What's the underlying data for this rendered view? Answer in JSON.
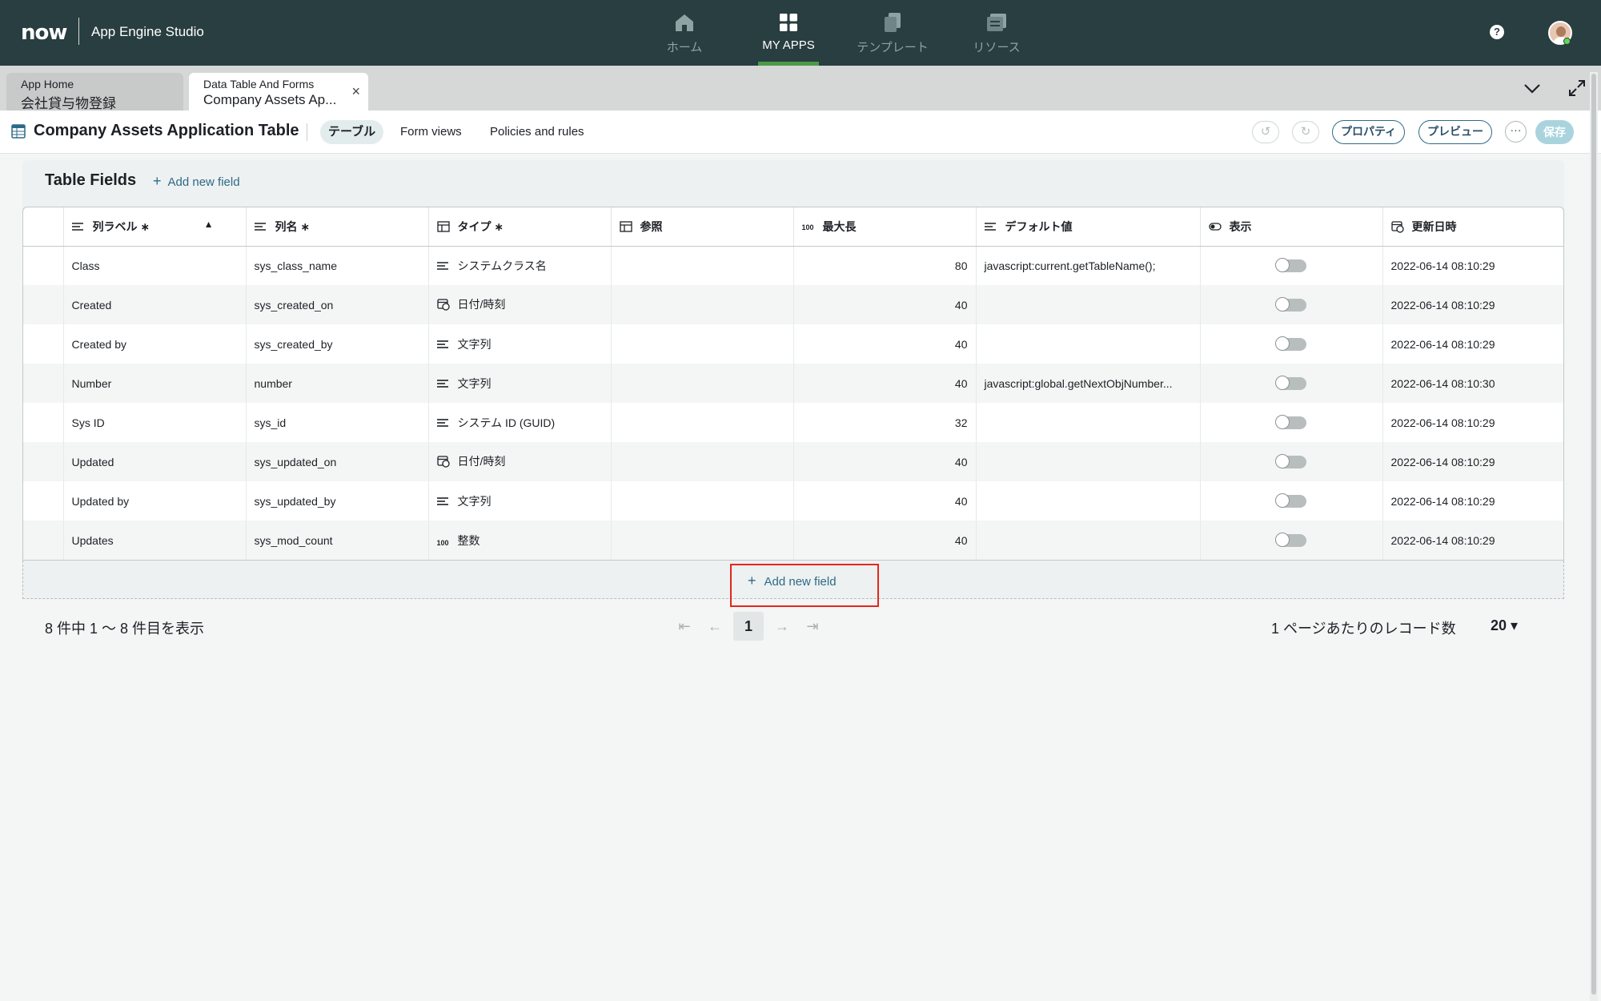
{
  "header": {
    "logo": "now",
    "app_name": "App Engine Studio",
    "nav": [
      {
        "label": "ホーム",
        "icon": "home-icon"
      },
      {
        "label": "MY APPS",
        "icon": "apps-grid-icon"
      },
      {
        "label": "テンプレート",
        "icon": "template-icon"
      },
      {
        "label": "リソース",
        "icon": "resources-icon"
      }
    ],
    "help": "?"
  },
  "tabs": [
    {
      "line1": "App Home",
      "line2": "会社貸与物登録"
    },
    {
      "line1": "Data Table And Forms",
      "line2": "Company Assets Ap..."
    }
  ],
  "toolbar": {
    "title": "Company Assets Application Table",
    "tabs": [
      "テーブル",
      "Form views",
      "Policies and rules"
    ],
    "undo": "↺",
    "redo": "↻",
    "properties": "プロパティ",
    "preview": "プレビュー",
    "more": "···",
    "save": "保存"
  },
  "section": {
    "title": "Table Fields",
    "add_field": "Add new field"
  },
  "table": {
    "columns": [
      "列ラベル ∗",
      "列名 ∗",
      "タイプ ∗",
      "参照",
      "最大長",
      "デフォルト値",
      "表示",
      "更新日時"
    ],
    "max_len_icon_text": "100",
    "rows": [
      {
        "label": "Class",
        "name": "sys_class_name",
        "type": "システムクラス名",
        "type_icon": "text-lines-icon",
        "ref": "",
        "max": "80",
        "default": "javascript:current.getTableName();",
        "updated": "2022-06-14 08:10:29"
      },
      {
        "label": "Created",
        "name": "sys_created_on",
        "type": "日付/時刻",
        "type_icon": "calendar-clock-icon",
        "ref": "",
        "max": "40",
        "default": "",
        "updated": "2022-06-14 08:10:29"
      },
      {
        "label": "Created by",
        "name": "sys_created_by",
        "type": "文字列",
        "type_icon": "text-lines-icon",
        "ref": "",
        "max": "40",
        "default": "",
        "updated": "2022-06-14 08:10:29"
      },
      {
        "label": "Number",
        "name": "number",
        "type": "文字列",
        "type_icon": "text-lines-icon",
        "ref": "",
        "max": "40",
        "default": "javascript:global.getNextObjNumber...",
        "updated": "2022-06-14 08:10:30"
      },
      {
        "label": "Sys ID",
        "name": "sys_id",
        "type": "システム ID (GUID)",
        "type_icon": "text-lines-icon",
        "ref": "",
        "max": "32",
        "default": "",
        "updated": "2022-06-14 08:10:29"
      },
      {
        "label": "Updated",
        "name": "sys_updated_on",
        "type": "日付/時刻",
        "type_icon": "calendar-clock-icon",
        "ref": "",
        "max": "40",
        "default": "",
        "updated": "2022-06-14 08:10:29"
      },
      {
        "label": "Updated by",
        "name": "sys_updated_by",
        "type": "文字列",
        "type_icon": "text-lines-icon",
        "ref": "",
        "max": "40",
        "default": "",
        "updated": "2022-06-14 08:10:29"
      },
      {
        "label": "Updates",
        "name": "sys_mod_count",
        "type": "整数",
        "type_icon": "number-100-icon",
        "ref": "",
        "max": "40",
        "default": "",
        "updated": "2022-06-14 08:10:29"
      }
    ]
  },
  "footer": {
    "add_field": "Add new field",
    "count_text": "8 件中 1 〜 8 件目を表示",
    "current_page": "1",
    "per_page_label": "1 ページあたりのレコード数",
    "per_page_value": "20 ▾"
  },
  "colors": {
    "header_bg": "#293e40",
    "accent": "#2d6a88",
    "highlight_box": "#e3271c"
  }
}
